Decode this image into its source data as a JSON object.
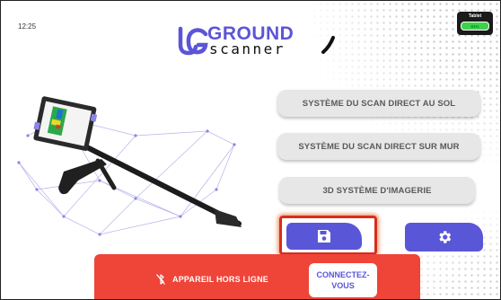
{
  "status_bar": {
    "time": "12:25",
    "tablet_label": "Tablet",
    "battery_level": "81%",
    "battery_color": "#3fd14a"
  },
  "logo": {
    "ground": "GROUND",
    "scanner": "scanner",
    "brand_color": "#5c55d6"
  },
  "menu": {
    "ground_scan": "SYSTÈME DU SCAN DIRECT AU SOL",
    "wall_scan": "SYSTÈME DU SCAN DIRECT SUR MUR",
    "imaging_3d": "3D SYSTÈME D'IMAGERIE"
  },
  "actions": {
    "save_icon": "floppy-disk-icon",
    "settings_icon": "gear-icon",
    "button_color": "#5a56d8",
    "highlight_color": "#d92c1a"
  },
  "offline": {
    "status_text": "APPAREIL HORS LIGNE",
    "connect_label_line1": "CONNECTEZ-",
    "connect_label_line2": "VOUS",
    "icon": "bluetooth-off-icon",
    "banner_color": "#ef4438"
  }
}
